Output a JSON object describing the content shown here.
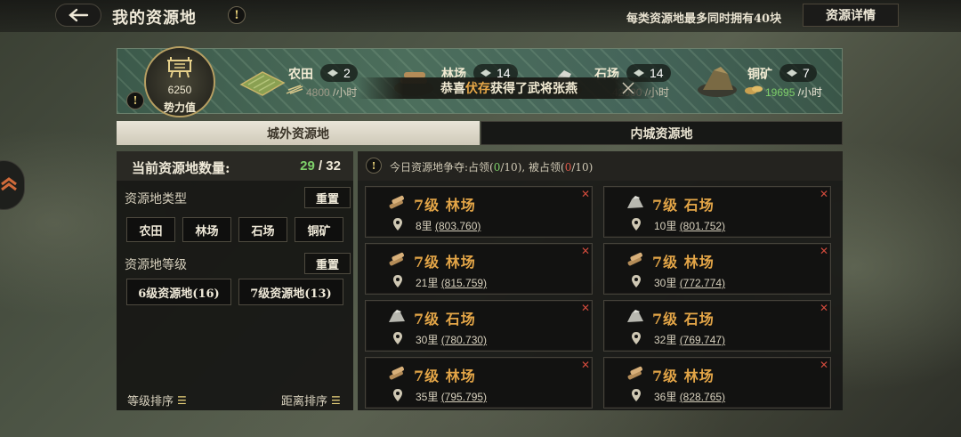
{
  "header": {
    "title": "我的资源地",
    "info": "!",
    "limit_text": "每类资源地最多同时拥有40块",
    "detail_button": "资源详情"
  },
  "banner": {
    "power_value": "6250",
    "power_label": "势力值",
    "warn": "!",
    "resources": [
      {
        "name": "农田",
        "count": "2",
        "rate": "4800",
        "unit": "/小时",
        "rate_color": "#c9c2ae"
      },
      {
        "name": "林场",
        "count": "14"
      },
      {
        "name": "石场",
        "count": "14",
        "rate": "42000",
        "unit": "/小时",
        "rate_color": "#c9c2ae"
      },
      {
        "name": "铜矿",
        "count": "7",
        "rate": "19695",
        "unit": "/小时",
        "rate_color": "#7ed06a"
      }
    ],
    "toast": {
      "pre": "恭喜",
      "name": "伏存",
      "post": "获得了武将张燕"
    }
  },
  "tabs": [
    {
      "label": "城外资源地",
      "active": true
    },
    {
      "label": "内城资源地",
      "active": false
    }
  ],
  "left": {
    "count_label": "当前资源地数量:",
    "count_current": "29",
    "count_total": "/ 32",
    "type_label": "资源地类型",
    "reset": "重置",
    "types": [
      "农田",
      "林场",
      "石场",
      "铜矿"
    ],
    "level_label": "资源地等级",
    "levels": [
      "6级资源地(16)",
      "7级资源地(13)"
    ],
    "sort_level": "等级排序",
    "sort_distance": "距离排序"
  },
  "right": {
    "contest": {
      "prefix": "今日资源地争夺:占领(",
      "occupied": "0",
      "mid": "/10), 被占领(",
      "lost": "0",
      "suffix": "/10)"
    },
    "cards": [
      {
        "icon": "wood-icon",
        "title": "7级 林场",
        "dist": "8里",
        "coord": "(803.760)"
      },
      {
        "icon": "stone-icon",
        "title": "7级 石场",
        "dist": "10里",
        "coord": "(801.752)"
      },
      {
        "icon": "wood-icon",
        "title": "7级 林场",
        "dist": "21里",
        "coord": "(815.759)"
      },
      {
        "icon": "wood-icon",
        "title": "7级 林场",
        "dist": "30里",
        "coord": "(772.774)"
      },
      {
        "icon": "stone-icon",
        "title": "7级 石场",
        "dist": "30里",
        "coord": "(780.730)"
      },
      {
        "icon": "stone-icon",
        "title": "7级 石场",
        "dist": "32里",
        "coord": "(769.747)"
      },
      {
        "icon": "wood-icon",
        "title": "7级 林场",
        "dist": "35里",
        "coord": "(795.795)"
      },
      {
        "icon": "wood-icon",
        "title": "7级 林场",
        "dist": "36里",
        "coord": "(828.765)"
      }
    ],
    "close_glyph": "✕"
  },
  "colors": {
    "accent_gold": "#e3a547",
    "green": "#7ed06a",
    "red": "#e05a4a"
  }
}
